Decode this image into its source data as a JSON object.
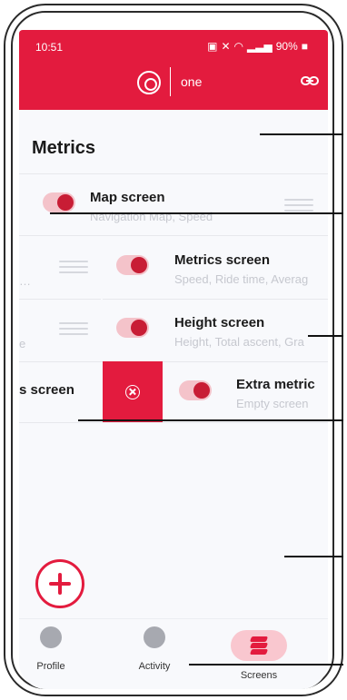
{
  "status_bar": {
    "time": "10:51",
    "battery": "90%"
  },
  "header": {
    "brand": "one",
    "link_icon": "link-icon"
  },
  "page": {
    "title": "Metrics"
  },
  "screens": [
    {
      "title": "Map screen",
      "subtitle": "Navigation Map, Speed",
      "enabled": true
    },
    {
      "title": "Metrics screen",
      "subtitle": "Speed, Ride time, Averag",
      "enabled": true
    },
    {
      "title": "Height screen",
      "subtitle": "Height, Total ascent, Gra",
      "enabled": true
    },
    {
      "title": "Extra metric",
      "subtitle": "Empty screen",
      "enabled": true
    }
  ],
  "swipe_row": {
    "partial_left_text": "s screen"
  },
  "left_fragments": {
    "row2": "…",
    "row3": "e"
  },
  "actions": {
    "delete_icon": "delete-x-circle-icon",
    "fab_icon": "plus-icon"
  },
  "bottom_nav": {
    "items": [
      {
        "label": "Profile",
        "icon": "profile-icon"
      },
      {
        "label": "Activity",
        "icon": "activity-icon"
      },
      {
        "label": "Screens",
        "icon": "layers-icon",
        "selected": true
      }
    ]
  },
  "colors": {
    "accent": "#e31b3e",
    "toggle_track": "#f4c3ca",
    "toggle_knob": "#c81d35",
    "background": "#f8f9fc"
  }
}
